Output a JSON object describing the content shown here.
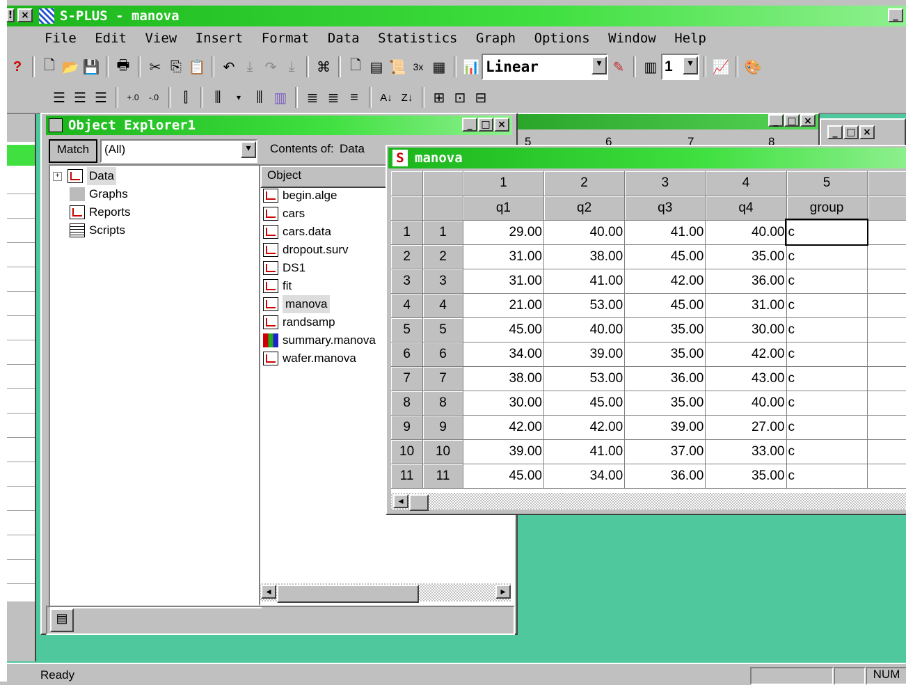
{
  "app": {
    "title": "S-PLUS - manova",
    "menus": [
      "File",
      "Edit",
      "View",
      "Insert",
      "Format",
      "Data",
      "Statistics",
      "Graph",
      "Options",
      "Window",
      "Help"
    ],
    "scale_select": "Linear",
    "page_select": "1",
    "status": "Ready",
    "status_num": "NUM"
  },
  "explorer": {
    "title": "Object Explorer1",
    "match_label": "Match",
    "match_value": "(All)",
    "contents_label": "Contents of:",
    "contents_value": "Data",
    "tree": [
      "Data",
      "Graphs",
      "Reports",
      "Scripts"
    ],
    "object_header": "Object",
    "objects": [
      "begin.alge",
      "cars",
      "cars.data",
      "dropout.surv",
      "DS1",
      "fit",
      "manova",
      "randsamp",
      "summary.manova",
      "wafer.manova"
    ]
  },
  "background_window": {
    "col_labels": [
      "5",
      "6",
      "7",
      "8"
    ]
  },
  "sheet": {
    "title": "manova",
    "col_numbers": [
      "1",
      "2",
      "3",
      "4",
      "5"
    ],
    "col_names": [
      "q1",
      "q2",
      "q3",
      "q4",
      "group"
    ],
    "rows": [
      {
        "num": "1",
        "id": "1",
        "q1": "29.00",
        "q2": "40.00",
        "q3": "41.00",
        "q4": "40.00",
        "group": "c"
      },
      {
        "num": "2",
        "id": "2",
        "q1": "31.00",
        "q2": "38.00",
        "q3": "45.00",
        "q4": "35.00",
        "group": "c"
      },
      {
        "num": "3",
        "id": "3",
        "q1": "31.00",
        "q2": "41.00",
        "q3": "42.00",
        "q4": "36.00",
        "group": "c"
      },
      {
        "num": "4",
        "id": "4",
        "q1": "21.00",
        "q2": "53.00",
        "q3": "45.00",
        "q4": "31.00",
        "group": "c"
      },
      {
        "num": "5",
        "id": "5",
        "q1": "45.00",
        "q2": "40.00",
        "q3": "35.00",
        "q4": "30.00",
        "group": "c"
      },
      {
        "num": "6",
        "id": "6",
        "q1": "34.00",
        "q2": "39.00",
        "q3": "35.00",
        "q4": "42.00",
        "group": "c"
      },
      {
        "num": "7",
        "id": "7",
        "q1": "38.00",
        "q2": "53.00",
        "q3": "36.00",
        "q4": "43.00",
        "group": "c"
      },
      {
        "num": "8",
        "id": "8",
        "q1": "30.00",
        "q2": "45.00",
        "q3": "35.00",
        "q4": "40.00",
        "group": "c"
      },
      {
        "num": "9",
        "id": "9",
        "q1": "42.00",
        "q2": "42.00",
        "q3": "39.00",
        "q4": "27.00",
        "group": "c"
      },
      {
        "num": "10",
        "id": "10",
        "q1": "39.00",
        "q2": "41.00",
        "q3": "37.00",
        "q4": "33.00",
        "group": "c"
      },
      {
        "num": "11",
        "id": "11",
        "q1": "45.00",
        "q2": "34.00",
        "q3": "36.00",
        "q4": "35.00",
        "group": "c"
      }
    ]
  },
  "colors": {
    "title_green": "#1bb51b",
    "mdi_background": "#4ec89c",
    "chrome": "#c0c0c0"
  }
}
